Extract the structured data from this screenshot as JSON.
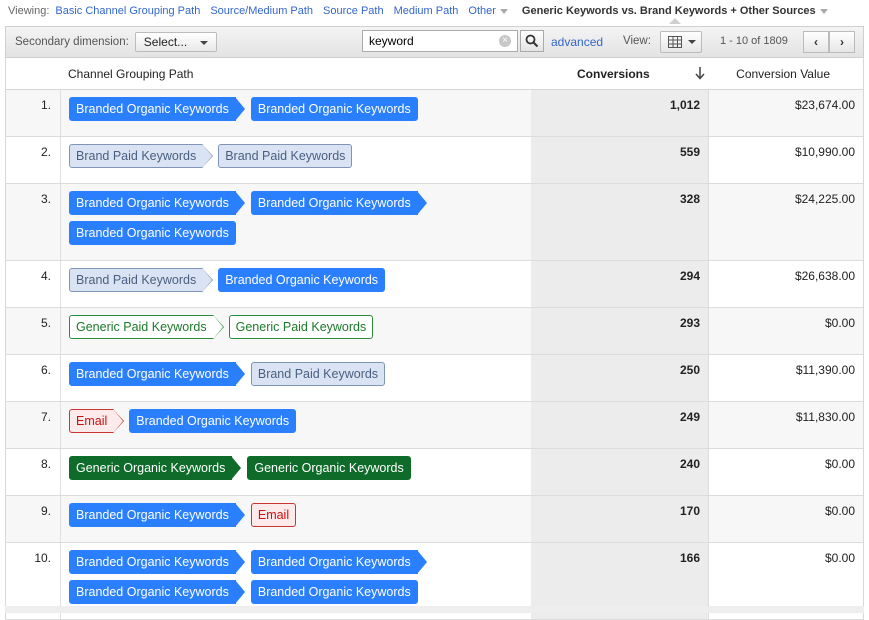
{
  "viewing": {
    "label": "Viewing:",
    "links": [
      "Basic Channel Grouping Path",
      "Source/Medium Path",
      "Source Path",
      "Medium Path"
    ],
    "other": "Other",
    "active": "Generic Keywords vs. Brand Keywords + Other Sources"
  },
  "toolbar": {
    "secondary_label": "Secondary dimension:",
    "select_label": "Select...",
    "search_value": "keyword",
    "advanced": "advanced",
    "view_label": "View:",
    "page_info": "1 - 10 of 1809",
    "prev": "‹",
    "next": "›"
  },
  "table": {
    "headers": {
      "path": "Channel Grouping Path",
      "conversions": "Conversions",
      "value": "Conversion Value"
    },
    "rows": [
      {
        "num": "1.",
        "conversions": "1,012",
        "value": "$23,674.00",
        "path": [
          {
            "label": "Branded Organic Keywords",
            "type": "branded-organic"
          },
          {
            "label": "Branded Organic Keywords",
            "type": "branded-organic"
          }
        ]
      },
      {
        "num": "2.",
        "conversions": "559",
        "value": "$10,990.00",
        "path": [
          {
            "label": "Brand Paid Keywords",
            "type": "brand-paid"
          },
          {
            "label": "Brand Paid Keywords",
            "type": "brand-paid"
          }
        ]
      },
      {
        "num": "3.",
        "conversions": "328",
        "value": "$24,225.00",
        "path": [
          {
            "label": "Branded Organic Keywords",
            "type": "branded-organic"
          },
          {
            "label": "Branded Organic Keywords",
            "type": "branded-organic"
          },
          {
            "label": "Branded Organic Keywords",
            "type": "branded-organic"
          }
        ]
      },
      {
        "num": "4.",
        "conversions": "294",
        "value": "$26,638.00",
        "path": [
          {
            "label": "Brand Paid Keywords",
            "type": "brand-paid"
          },
          {
            "label": "Branded Organic Keywords",
            "type": "branded-organic"
          }
        ]
      },
      {
        "num": "5.",
        "conversions": "293",
        "value": "$0.00",
        "path": [
          {
            "label": "Generic Paid Keywords",
            "type": "generic-paid"
          },
          {
            "label": "Generic Paid Keywords",
            "type": "generic-paid"
          }
        ]
      },
      {
        "num": "6.",
        "conversions": "250",
        "value": "$11,390.00",
        "path": [
          {
            "label": "Branded Organic Keywords",
            "type": "branded-organic"
          },
          {
            "label": "Brand Paid Keywords",
            "type": "brand-paid"
          }
        ]
      },
      {
        "num": "7.",
        "conversions": "249",
        "value": "$11,830.00",
        "path": [
          {
            "label": "Email",
            "type": "email"
          },
          {
            "label": "Branded Organic Keywords",
            "type": "branded-organic"
          }
        ]
      },
      {
        "num": "8.",
        "conversions": "240",
        "value": "$0.00",
        "path": [
          {
            "label": "Generic Organic Keywords",
            "type": "generic-organic"
          },
          {
            "label": "Generic Organic Keywords",
            "type": "generic-organic"
          }
        ]
      },
      {
        "num": "9.",
        "conversions": "170",
        "value": "$0.00",
        "path": [
          {
            "label": "Branded Organic Keywords",
            "type": "branded-organic"
          },
          {
            "label": "Email",
            "type": "email"
          }
        ]
      },
      {
        "num": "10.",
        "conversions": "166",
        "value": "$0.00",
        "path": [
          {
            "label": "Branded Organic Keywords",
            "type": "branded-organic"
          },
          {
            "label": "Branded Organic Keywords",
            "type": "branded-organic"
          },
          {
            "label": "Branded Organic Keywords",
            "type": "branded-organic"
          },
          {
            "label": "Branded Organic Keywords",
            "type": "branded-organic"
          }
        ]
      }
    ]
  },
  "icons": {
    "search": "magnifier-icon",
    "clear": "clear-x-icon",
    "view": "table-grid-icon",
    "sort": "sort-down-arrow-icon"
  },
  "colors": {
    "branded_organic": "#2a7fff",
    "brand_paid": "#dae3f3",
    "generic_paid_border": "#2e8b3a",
    "generic_organic": "#0f6b2a",
    "email": "#cc3333",
    "link": "#3366cc"
  }
}
